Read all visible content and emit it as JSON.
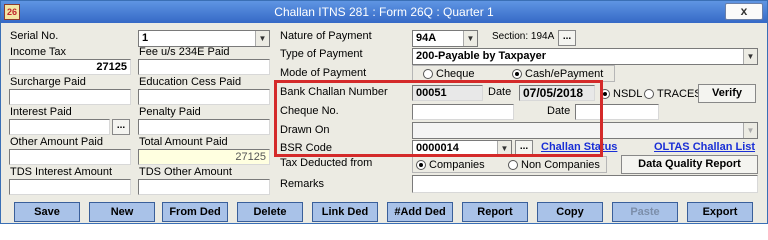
{
  "window": {
    "title": "Challan ITNS 281 : Form 26Q : Quarter 1",
    "app_icon_text": "26",
    "close_label": "x"
  },
  "left": {
    "serial_no_label": "Serial No.",
    "serial_no_value": "1",
    "income_tax_label": "Income Tax",
    "income_tax_value": "27125",
    "fee_label": "Fee u/s 234E Paid",
    "fee_value": "",
    "surcharge_label": "Surcharge Paid",
    "surcharge_value": "",
    "education_cess_label": "Education Cess Paid",
    "education_cess_value": "",
    "interest_label": "Interest Paid",
    "interest_value": "",
    "interest_dots": "...",
    "penalty_label": "Penalty Paid",
    "penalty_value": "",
    "other_amount_label": "Other Amount Paid",
    "other_amount_value": "",
    "total_amount_label": "Total Amount Paid",
    "total_amount_value": "27125",
    "tds_interest_label": "TDS Interest Amount",
    "tds_interest_value": "",
    "tds_other_label": "TDS Other Amount",
    "tds_other_value": ""
  },
  "right": {
    "nature_label": "Nature of Payment",
    "nature_value": "94A",
    "section_label": "Section: 194A",
    "section_dots": "...",
    "type_label": "Type of Payment",
    "type_value": "200-Payable by Taxpayer",
    "mode_label": "Mode of Payment",
    "mode_cheque": "Cheque",
    "mode_cash": "Cash/ePayment",
    "bank_challan_label": "Bank Challan Number",
    "bank_challan_value": "00051",
    "date_label": "Date",
    "date_value": "07/05/2018",
    "nsdl_label": "NSDL",
    "traces_label": "TRACES",
    "verify_label": "Verify",
    "cheque_no_label": "Cheque No.",
    "cheque_no_value": "",
    "cheque_date_label": "Date",
    "cheque_date_value": "",
    "drawn_on_label": "Drawn On",
    "drawn_on_value": "",
    "bsr_label": "BSR Code",
    "bsr_value": "0000014",
    "bsr_dots": "...",
    "challan_status_label": "Challan Status",
    "oltas_label": "OLTAS Challan List",
    "tax_deducted_label": "Tax Deducted from",
    "companies_label": "Companies",
    "non_companies_label": "Non Companies",
    "data_quality_label": "Data Quality Report",
    "remarks_label": "Remarks",
    "remarks_value": ""
  },
  "buttons": {
    "save": "Save",
    "new": "New",
    "from_ded": "From Ded",
    "delete": "Delete",
    "link_ded": "Link Ded",
    "add_ded": "#Add Ded",
    "report": "Report",
    "copy": "Copy",
    "paste": "Paste",
    "export": "Export"
  },
  "colors": {
    "title_bar": "#3569c6",
    "button_bg": "#a9c2e8",
    "highlight_box": "#d42a2a",
    "link": "#1a2fd6"
  }
}
